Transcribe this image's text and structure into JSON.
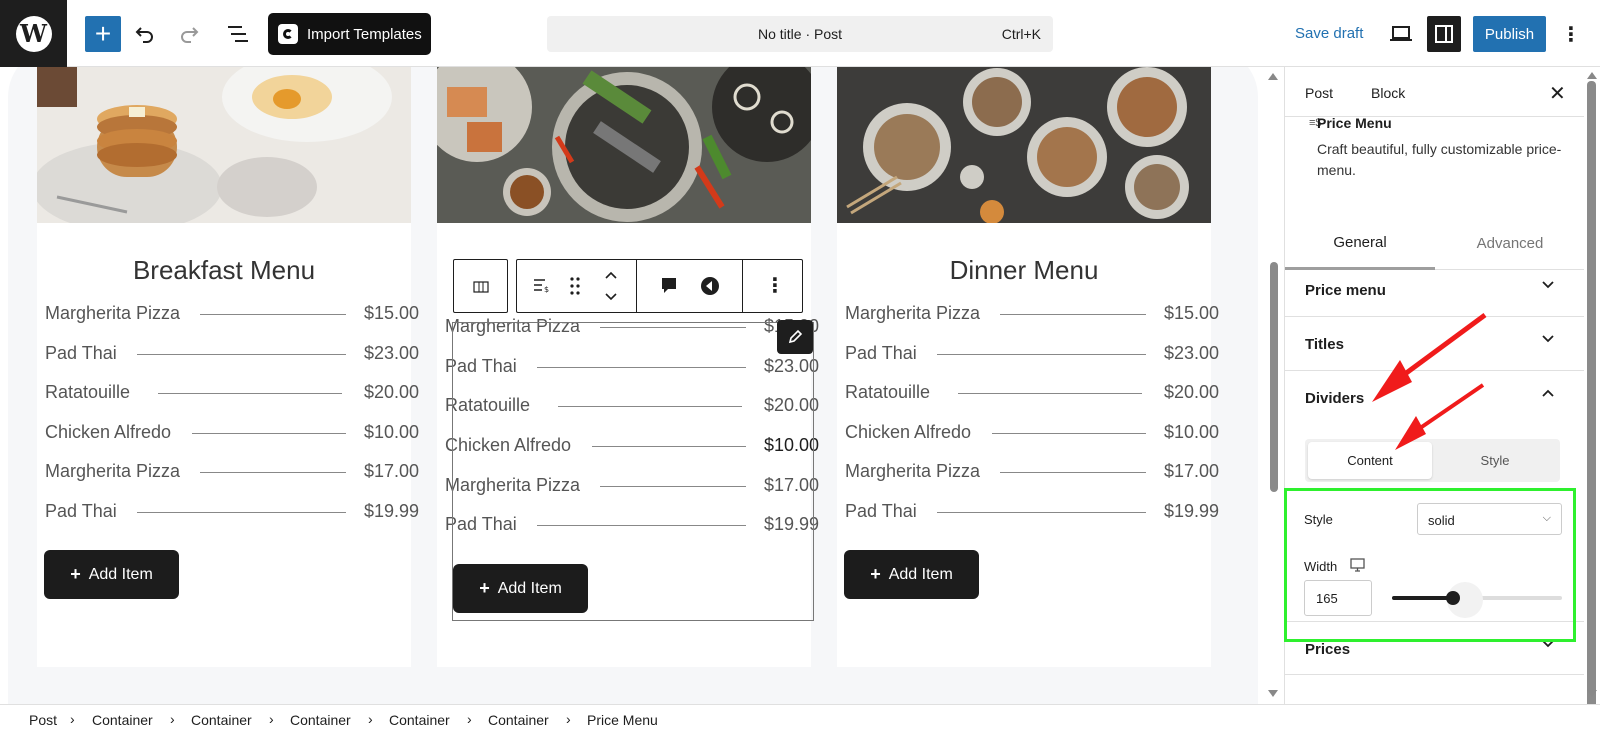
{
  "topbar": {
    "import_templates": "Import Templates",
    "doc_title": "No title · Post",
    "shortcut": "Ctrl+K",
    "save_draft": "Save draft",
    "publish": "Publish",
    "brand_color": "#2271b1"
  },
  "cards": [
    {
      "title": "Breakfast Menu",
      "items": [
        {
          "name": "Margherita Pizza",
          "price": "$15.00"
        },
        {
          "name": "Pad Thai",
          "price": "$23.00"
        },
        {
          "name": "Ratatouille",
          "price": "$20.00"
        },
        {
          "name": "Chicken Alfredo",
          "price": "$10.00"
        },
        {
          "name": "Margherita Pizza",
          "price": "$17.00"
        },
        {
          "name": "Pad Thai",
          "price": "$19.99"
        }
      ],
      "add_item": "Add Item"
    },
    {
      "title": "",
      "items": [
        {
          "name": "Margherita Pizza",
          "price": "$15.00"
        },
        {
          "name": "Pad Thai",
          "price": "$23.00"
        },
        {
          "name": "Ratatouille",
          "price": "$20.00"
        },
        {
          "name": "Chicken Alfredo",
          "price": "$10.00"
        },
        {
          "name": "Margherita Pizza",
          "price": "$17.00"
        },
        {
          "name": "Pad Thai",
          "price": "$19.99"
        }
      ],
      "add_item": "Add Item"
    },
    {
      "title": "Dinner Menu",
      "items": [
        {
          "name": "Margherita Pizza",
          "price": "$15.00"
        },
        {
          "name": "Pad Thai",
          "price": "$23.00"
        },
        {
          "name": "Ratatouille",
          "price": "$20.00"
        },
        {
          "name": "Chicken Alfredo",
          "price": "$10.00"
        },
        {
          "name": "Margherita Pizza",
          "price": "$17.00"
        },
        {
          "name": "Pad Thai",
          "price": "$19.99"
        }
      ],
      "add_item": "Add Item"
    }
  ],
  "sidebar": {
    "tab_post": "Post",
    "tab_block": "Block",
    "block_name": "Price Menu",
    "block_description": "Craft beautiful, fully customizable price-menu.",
    "tab_general": "General",
    "tab_advanced": "Advanced",
    "panels": {
      "price_menu": "Price menu",
      "titles": "Titles",
      "dividers": "Dividers",
      "prices": "Prices"
    },
    "segment_content": "Content",
    "segment_style": "Style",
    "style_label": "Style",
    "style_value": "solid",
    "width_label": "Width",
    "width_value": "165",
    "width_fraction": 0.36
  },
  "breadcrumb": [
    "Post",
    "Container",
    "Container",
    "Container",
    "Container",
    "Container",
    "Price Menu"
  ],
  "icons": [
    "wordpress-logo-icon",
    "plus-icon",
    "undo-icon",
    "redo-icon",
    "list-view-icon",
    "desktop-view-icon",
    "sidebar-toggle-icon",
    "more-vertical-icon",
    "close-icon",
    "chevron-down-icon",
    "chevron-up-icon",
    "desktop-device-icon",
    "pencil-icon",
    "drag-handle-icon",
    "comment-icon",
    "arrow-left-circle-icon"
  ],
  "annotation_color": "#2ef02e"
}
